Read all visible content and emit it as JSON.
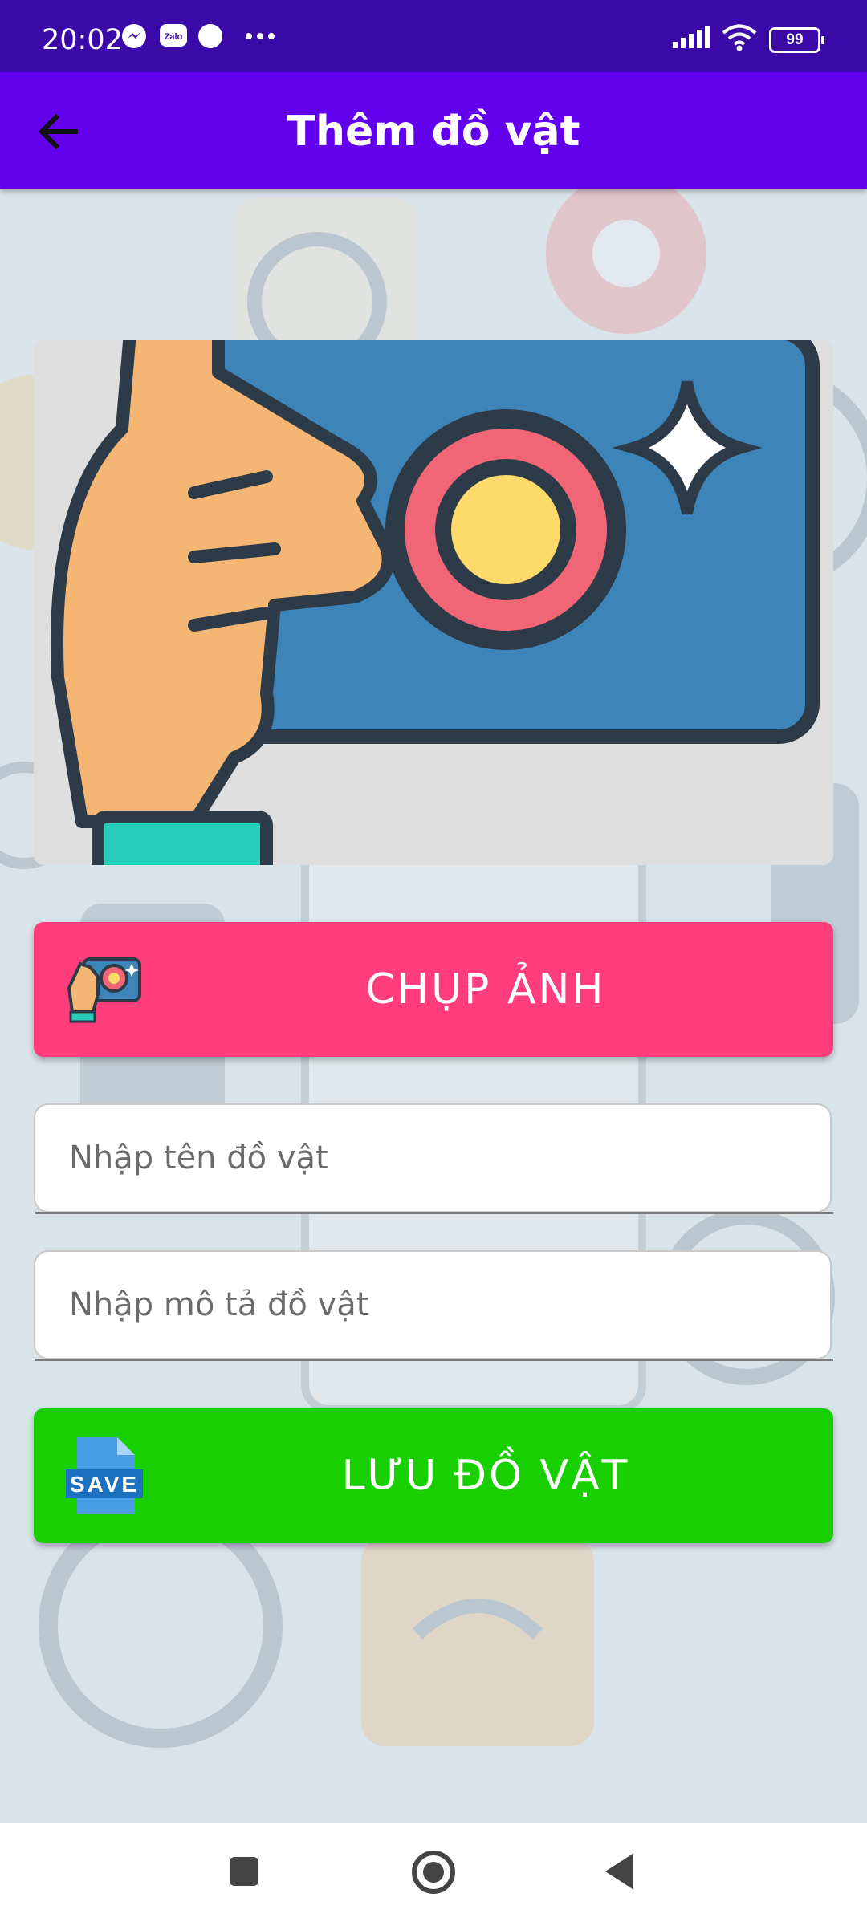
{
  "status_bar": {
    "time": "20:02",
    "battery": "99",
    "icons": [
      "messenger-icon",
      "zalo-icon",
      "dot-icon",
      "more-icon",
      "signal-icon",
      "wifi-icon",
      "battery-icon"
    ],
    "zalo_text": "Zalo"
  },
  "app_bar": {
    "title": "Thêm đồ vật",
    "back_icon": "arrow-back-icon"
  },
  "hero": {
    "icon": "hand-camera-illustration"
  },
  "capture_button": {
    "label": "CHỤP ẢNH",
    "icon": "hand-camera-icon"
  },
  "name_field": {
    "value": "",
    "placeholder": "Nhập tên đồ vật"
  },
  "description_field": {
    "value": "",
    "placeholder": "Nhập mô tả đồ vật"
  },
  "save_button": {
    "label": "LƯU ĐỒ VẬT",
    "icon": "save-file-icon",
    "icon_text": "SAVE"
  },
  "nav_bar": {
    "buttons": [
      "recents-button",
      "home-button",
      "back-button"
    ]
  },
  "colors": {
    "status_bar": "#3a09a8",
    "app_bar": "#6200ee",
    "capture_button": "#ff3d7d",
    "save_button": "#18cf00",
    "field_bg": "#ffffff"
  }
}
